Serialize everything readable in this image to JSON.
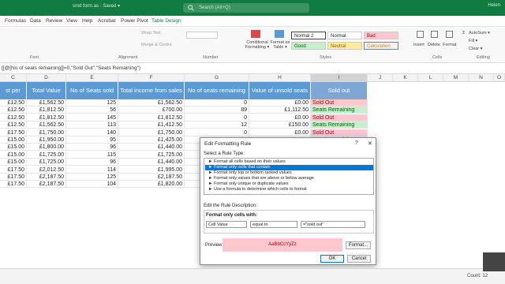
{
  "window": {
    "doc_title": "smd form as - Saved ▾",
    "search_placeholder": "Search (Alt+Q)",
    "user": "Helen"
  },
  "tabs": [
    "Formulas",
    "Data",
    "Review",
    "View",
    "Help",
    "Acrobat",
    "Power Pivot",
    "Table Design"
  ],
  "ribbon": {
    "groups": {
      "font": "Font",
      "alignment": "Alignment",
      "number": "Number",
      "styles": "Styles",
      "cells": "Cells",
      "editing": "Editing"
    },
    "wrap_text": "Wrap Text",
    "merge_center": "Merge & Centre",
    "conditional_formatting": "Conditional Formatting ▾",
    "format_as_table": "Format as Table ▾",
    "styles": {
      "normal2": "Normal 2",
      "normal": "Normal",
      "bad": "Bad",
      "good": "Good",
      "neutral": "Neutral",
      "calculation": "Calculation"
    },
    "insert": "Insert",
    "delete": "Delete",
    "format": "Format",
    "autosum": "AutoSum ▾",
    "fill": "Fill ▾",
    "clear": "Clear ▾"
  },
  "formula_bar": "[[@[No of seats remaining]]=0,\"Sold Out\",\"Seats Remaining\")",
  "columns": [
    "C",
    "D",
    "E",
    "F",
    "G",
    "H",
    "I",
    "J",
    "K",
    "L",
    "M",
    "N",
    "O"
  ],
  "table": {
    "headers": [
      "st per seat",
      "Total Value",
      "No of Seats sold",
      "Total income from sales",
      "No of seats remaining",
      "Value of unsold seats",
      "Sold out"
    ],
    "rows": [
      [
        "£12.50",
        "£1,562.50",
        "125",
        "£1,562.50",
        "0",
        "£0.00",
        "Sold Out"
      ],
      [
        "£12.50",
        "£1,812.50",
        "56",
        "£700.00",
        "89",
        "£1,112.50",
        "Seats Remaining"
      ],
      [
        "£12.50",
        "£1,812.50",
        "145",
        "£1,812.50",
        "0",
        "£0.00",
        "Sold Out"
      ],
      [
        "£12.50",
        "£1,562.50",
        "113",
        "£1,412.50",
        "12",
        "£150.00",
        "Seats Remaining"
      ],
      [
        "£17.50",
        "£1,750.00",
        "140",
        "£1,750.00",
        "0",
        "£0.00",
        "Sold Out"
      ],
      [
        "£15.00",
        "£1,950.00",
        "95",
        "£1,425.00",
        "35",
        "£525.00",
        "Seats Remaining"
      ],
      [
        "£15.00",
        "£1,800.00",
        "96",
        "£1,440.00",
        "",
        "",
        ""
      ],
      [
        "£15.00",
        "£1,725.00",
        "115",
        "£1,725.00",
        "",
        "",
        ""
      ],
      [
        "£15.00",
        "£1,725.00",
        "96",
        "£1,440.00",
        "",
        "",
        ""
      ],
      [
        "£17.50",
        "£2,012.50",
        "114",
        "£1,995.00",
        "",
        "",
        ""
      ],
      [
        "£17.50",
        "£2,187.50",
        "125",
        "£2,187.50",
        "",
        "",
        ""
      ],
      [
        "£17.50",
        "£2,187.50",
        "104",
        "£1,820.00",
        "",
        "",
        ""
      ]
    ]
  },
  "dialog": {
    "title": "Edit Formatting Rule",
    "help": "?",
    "close": "✕",
    "select_rule_type": "Select a Rule Type:",
    "rules": [
      "► Format all cells based on their values",
      "► Format only cells that contain",
      "► Format only top or bottom ranked values",
      "► Format only values that are above or below average",
      "► Format only unique or duplicate values",
      "► Use a formula to determine which cells to format"
    ],
    "selected_rule": 1,
    "edit_desc": "Edit the Rule Description:",
    "format_only_cells_with": "Format only cells with:",
    "cond1": "Cell Value",
    "cond2": "equal to",
    "cond3": "=\"sold out\"",
    "preview_label": "Preview:",
    "preview_text": "AaBbCcYyZz",
    "format_btn": "Format...",
    "ok": "OK",
    "cancel": "Cancel"
  },
  "status": {
    "count": "Count: 12"
  }
}
